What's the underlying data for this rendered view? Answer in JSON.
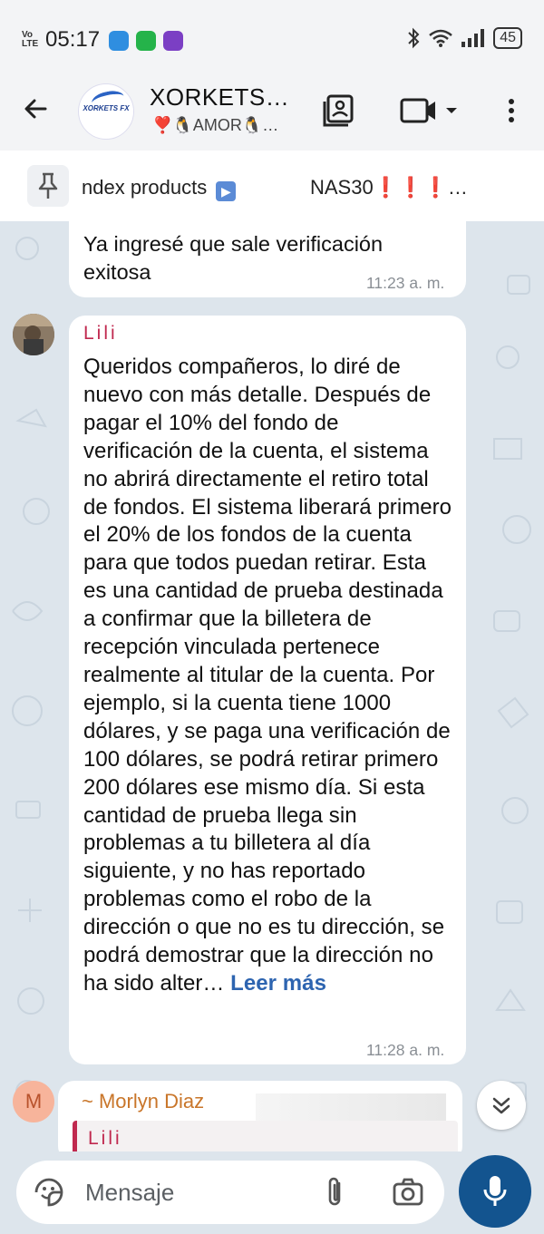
{
  "status_bar": {
    "volte": "Vo\nLTE",
    "time": "05:17",
    "battery": "45"
  },
  "header": {
    "title": "XORKETS…",
    "subtitle": "❣️🐧AMOR🐧…",
    "avatar_logo_text": "XORKETS FX"
  },
  "pinned": {
    "text1": "ndex products",
    "text2_prefix": "NAS30",
    "text2_suffix": "…"
  },
  "messages": [
    {
      "text": "Ya ingresé que sale verificación exitosa",
      "time": "11:23 a. m."
    },
    {
      "sender": "Lili",
      "body": "Queridos compañeros, lo diré de nuevo con más detalle. Después de pagar el 10% del fondo de verificación de la cuenta, el sistema no abrirá directamente el retiro total de fondos. El sistema liberará primero el 20% de los fondos de la cuenta para que todos puedan retirar. Esta es una cantidad de prueba destinada a confirmar que la billetera de recepción vinculada pertenece realmente al titular de la cuenta. Por ejemplo, si la cuenta tiene 1000 dólares, y se paga una verificación de 100 dólares, se podrá retirar primero 200 dólares ese mismo día. Si esta cantidad de prueba llega sin problemas a tu billetera al día siguiente, y no has reportado problemas como el robo de la dirección o que no es tu dirección, se podrá demostrar que la dirección no ha sido alter…",
      "read_more": "Leer más",
      "time": "11:28 a. m."
    },
    {
      "avatar_letter": "M",
      "sender": "~ Morlyn Diaz",
      "reply_to": "Lili"
    }
  ],
  "composer": {
    "placeholder": "Mensaje"
  },
  "colors": {
    "accent": "#13548f",
    "sender_lili": "#c0294f",
    "sender_morlyn": "#c9762a",
    "link": "#2d64b0"
  }
}
